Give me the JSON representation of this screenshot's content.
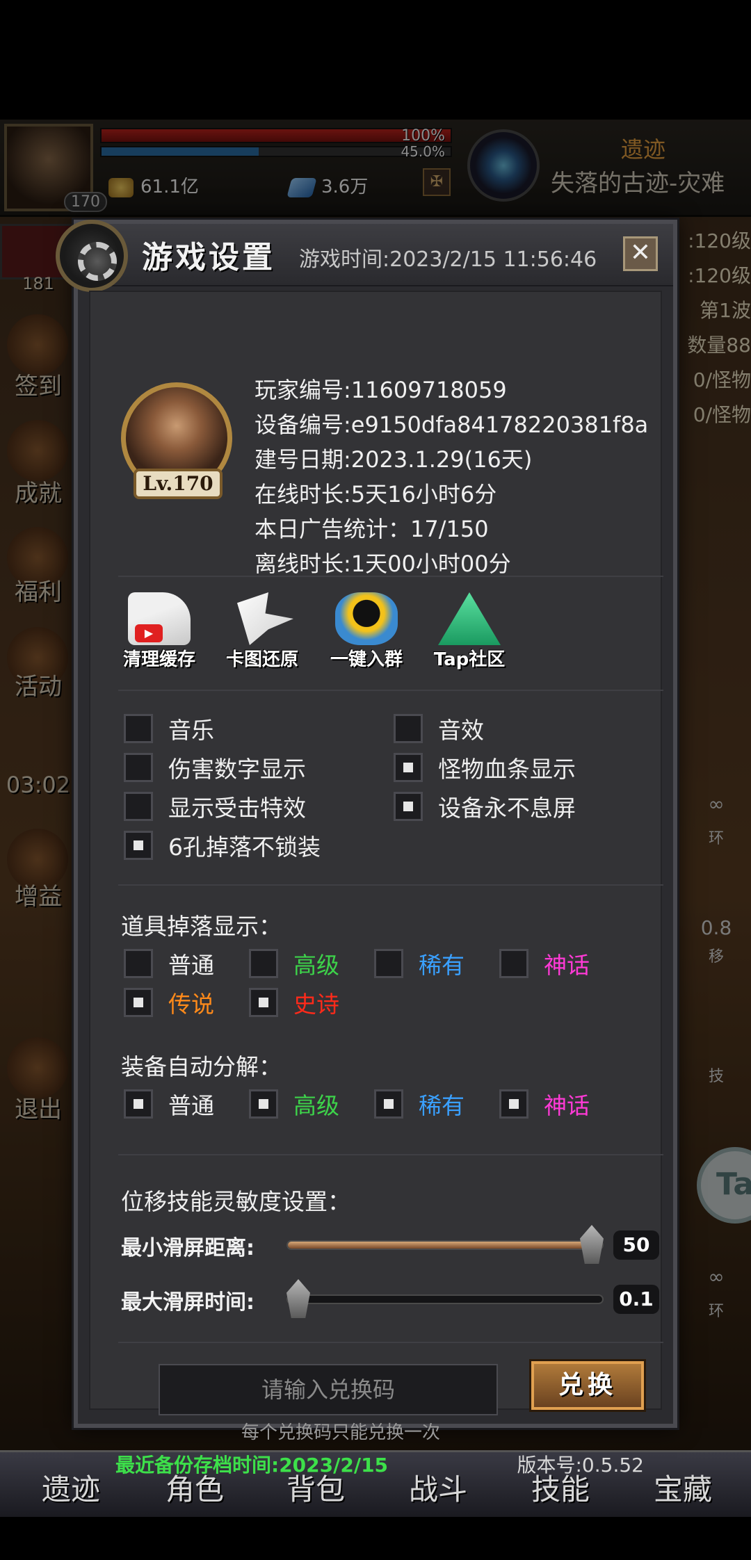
{
  "hud": {
    "player_level": "170",
    "hp_percent_label": "100%",
    "hp_fraction": 1.0,
    "mp_percent_label": "45.0%",
    "mp_fraction": 0.45,
    "gold": "61.1亿",
    "gems": "3.6万",
    "location_type": "遗迹",
    "location_name": "失落的古迹-灾难"
  },
  "side_info": [
    ":120级",
    ":120级",
    "第1波",
    "数量88",
    "0/怪物",
    "0/怪物"
  ],
  "left_menu": {
    "left_badge": "181",
    "items": [
      "签到",
      "成就",
      "福利",
      "活动",
      "增益",
      "退出"
    ],
    "timer": "03:02"
  },
  "right_rail": [
    "∞",
    "环",
    "0.8",
    "移",
    "技",
    "∞",
    "环"
  ],
  "bottom_nav": [
    "遗迹",
    "角色",
    "背包",
    "战斗",
    "技能",
    "宝藏"
  ],
  "dialog": {
    "title": "游戏设置",
    "game_time": "游戏时间:2023/2/15 11:56:46",
    "close_icon": "✕",
    "avatar_level": "Lv.170",
    "info": [
      "玩家编号:11609718059",
      "设备编号:e9150dfa84178220381f8a",
      "建号日期:2023.1.29(16天)",
      "在线时长:5天16小时6分",
      "本日广告统计：17/150",
      "离线时长:1天00小时00分"
    ],
    "quick_actions": [
      {
        "icon": "clear-cache-icon",
        "label": "清理缓存"
      },
      {
        "icon": "dove-icon",
        "label": "卡图还原"
      },
      {
        "icon": "qq-penguin-icon",
        "label": "一键入群"
      },
      {
        "icon": "tap-community-icon",
        "label": "Tap社区"
      }
    ],
    "options": [
      {
        "label": "音乐",
        "checked": false
      },
      {
        "label": "音效",
        "checked": false
      },
      {
        "label": "伤害数字显示",
        "checked": false
      },
      {
        "label": "怪物血条显示",
        "checked": true
      },
      {
        "label": "显示受击特效",
        "checked": false
      },
      {
        "label": "设备永不息屏",
        "checked": true
      },
      {
        "label": "6孔掉落不锁装",
        "checked": true
      }
    ],
    "drop_display": {
      "title": "道具掉落显示：",
      "items": [
        {
          "label": "普通",
          "checked": false,
          "color": "#efefef"
        },
        {
          "label": "高级",
          "checked": false,
          "color": "#3dd34a"
        },
        {
          "label": "稀有",
          "checked": false,
          "color": "#3aa0ff"
        },
        {
          "label": "神话",
          "checked": false,
          "color": "#ff3ad6"
        },
        {
          "label": "传说",
          "checked": true,
          "color": "#ff8a1a"
        },
        {
          "label": "史诗",
          "checked": true,
          "color": "#ff2a1a"
        }
      ]
    },
    "auto_decompose": {
      "title": "装备自动分解：",
      "items": [
        {
          "label": "普通",
          "checked": true,
          "color": "#efefef"
        },
        {
          "label": "高级",
          "checked": true,
          "color": "#3dd34a"
        },
        {
          "label": "稀有",
          "checked": true,
          "color": "#3aa0ff"
        },
        {
          "label": "神话",
          "checked": true,
          "color": "#ff3ad6"
        }
      ]
    },
    "sensitivity": {
      "title": "位移技能灵敏度设置：",
      "min_swipe_label": "最小滑屏距离:",
      "min_swipe_value": "50",
      "min_swipe_fraction": 1.0,
      "max_swipe_label": "最大滑屏时间:",
      "max_swipe_value": "0.1",
      "max_swipe_fraction": 0.0
    },
    "redeem": {
      "placeholder": "请输入兑换码",
      "button": "兑换",
      "note": "每个兑换码只能兑换一次"
    },
    "backup": "最近备份存档时间:2023/2/15",
    "version": "版本号:0.5.52"
  }
}
